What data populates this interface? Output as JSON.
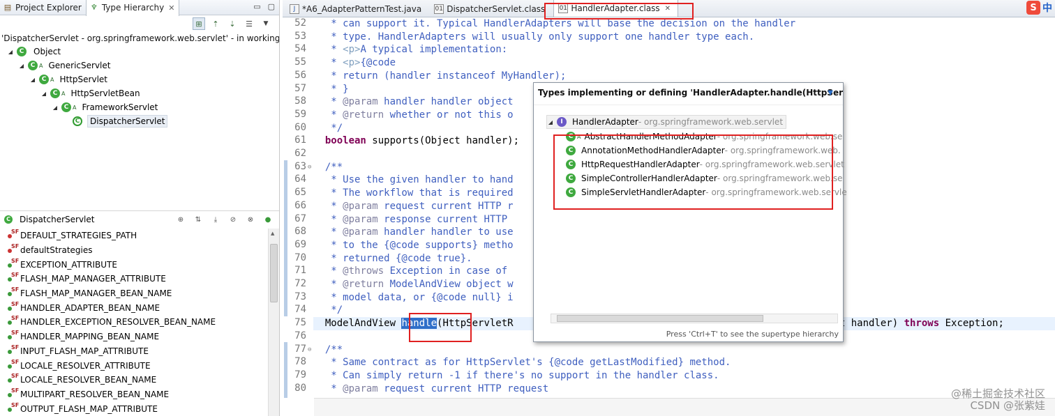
{
  "left": {
    "tabs": [
      {
        "label": "Project Explorer",
        "icon": "package-explorer-icon"
      },
      {
        "label": "Type Hierarchy",
        "icon": "type-hierarchy-icon",
        "active": true
      }
    ],
    "status_text": "'DispatcherServlet - org.springframework.web.servlet' - in working se",
    "tree": [
      {
        "label": "Object",
        "marker": ""
      },
      {
        "label": "GenericServlet",
        "marker": "A"
      },
      {
        "label": "HttpServlet",
        "marker": "A"
      },
      {
        "label": "HttpServletBean",
        "marker": "A"
      },
      {
        "label": "FrameworkServlet",
        "marker": "A"
      },
      {
        "label": "DispatcherServlet",
        "marker": ""
      }
    ],
    "members_title": "DispatcherServlet",
    "members": [
      "DEFAULT_STRATEGIES_PATH",
      "defaultStrategies",
      "EXCEPTION_ATTRIBUTE",
      "FLASH_MAP_MANAGER_ATTRIBUTE",
      "FLASH_MAP_MANAGER_BEAN_NAME",
      "HANDLER_ADAPTER_BEAN_NAME",
      "HANDLER_EXCEPTION_RESOLVER_BEAN_NAME",
      "HANDLER_MAPPING_BEAN_NAME",
      "INPUT_FLASH_MAP_ATTRIBUTE",
      "LOCALE_RESOLVER_ATTRIBUTE",
      "LOCALE_RESOLVER_BEAN_NAME",
      "MULTIPART_RESOLVER_BEAN_NAME",
      "OUTPUT_FLASH_MAP_ATTRIBUTE"
    ],
    "field_modifier": "SF"
  },
  "editor": {
    "tabs": [
      {
        "label": "*A6_AdapterPatternTest.java"
      },
      {
        "label": "DispatcherServlet.class"
      },
      {
        "label": "HandlerAdapter.class",
        "active": true
      }
    ],
    "ime": {
      "s": "S",
      "zh": "中"
    },
    "lines": [
      {
        "n": "52",
        "t": "   * can support it. Typical HandlerAdapters will base the decision on the handler"
      },
      {
        "n": "53",
        "t": "   * type. HandlerAdapters will usually only support one handler type each."
      },
      {
        "n": "54",
        "t": "   * <p>A typical implementation:"
      },
      {
        "n": "55",
        "t": "   * <p>{@code"
      },
      {
        "n": "56",
        "t": "   * return (handler instanceof MyHandler);"
      },
      {
        "n": "57",
        "t": "   * }"
      },
      {
        "n": "58",
        "t": "   * @param handler handler object"
      },
      {
        "n": "59",
        "t": "   * @return whether or not this o"
      },
      {
        "n": "60",
        "t": "   */"
      },
      {
        "n": "61",
        "t": "  boolean supports(Object handler);"
      },
      {
        "n": "62",
        "t": ""
      },
      {
        "n": "63",
        "t": "  /**"
      },
      {
        "n": "64",
        "t": "   * Use the given handler to hand"
      },
      {
        "n": "65",
        "t": "   * The workflow that is required"
      },
      {
        "n": "66",
        "t": "   * @param request current HTTP r"
      },
      {
        "n": "67",
        "t": "   * @param response current HTTP"
      },
      {
        "n": "68",
        "t": "   * @param handler handler to use"
      },
      {
        "n": "69",
        "t": "   * to the {@code supports} metho"
      },
      {
        "n": "70",
        "t": "   * returned {@code true}."
      },
      {
        "n": "71",
        "t": "   * @throws Exception in case of"
      },
      {
        "n": "72",
        "t": "   * @return ModelAndView object w"
      },
      {
        "n": "73",
        "t": "   * model data, or {@code null} i"
      },
      {
        "n": "74",
        "t": "   */"
      },
      {
        "n": "75",
        "t": "  ModelAndView handle(HttpServletR"
      },
      {
        "n": "76",
        "t": ""
      },
      {
        "n": "77",
        "t": "  /**"
      },
      {
        "n": "78",
        "t": "   * Same contract as for HttpServlet's {@code getLastModified} method."
      },
      {
        "n": "79",
        "t": "   * Can simply return -1 if there's no support in the handler class."
      },
      {
        "n": "80",
        "t": "   * @param request current HTTP request"
      }
    ],
    "line75_tail": "ect handler) throws Exception;",
    "highlighted_word": "handle"
  },
  "popup": {
    "title": "Types implementing or defining 'HandlerAdapter.handle(HttpServl",
    "root": {
      "name": "HandlerAdapter",
      "pkg": " - org.springframework.web.servlet"
    },
    "items": [
      {
        "name": "AbstractHandlerMethodAdapter",
        "pkg": " - org.springframework.web.se",
        "marker": "A"
      },
      {
        "name": "AnnotationMethodHandlerAdapter",
        "pkg": " - org.springframework.web.",
        "marker": ""
      },
      {
        "name": "HttpRequestHandlerAdapter",
        "pkg": " - org.springframework.web.servlet",
        "marker": ""
      },
      {
        "name": "SimpleControllerHandlerAdapter",
        "pkg": " - org.springframework.web.se",
        "marker": ""
      },
      {
        "name": "SimpleServletHandlerAdapter",
        "pkg": " - org.springframework.web.servle",
        "marker": ""
      }
    ],
    "footer": "Press 'Ctrl+T' to see the supertype hierarchy"
  },
  "watermark": {
    "line1": "@稀土掘金技术社区",
    "line2": "CSDN @张紫娃"
  },
  "colors": {
    "annotation_red": "#e02020",
    "class_green": "#3fa93f",
    "javadoc_blue": "#3f5fbf",
    "keyword_purple": "#7f0055",
    "selection_blue": "#2f6fc9"
  }
}
